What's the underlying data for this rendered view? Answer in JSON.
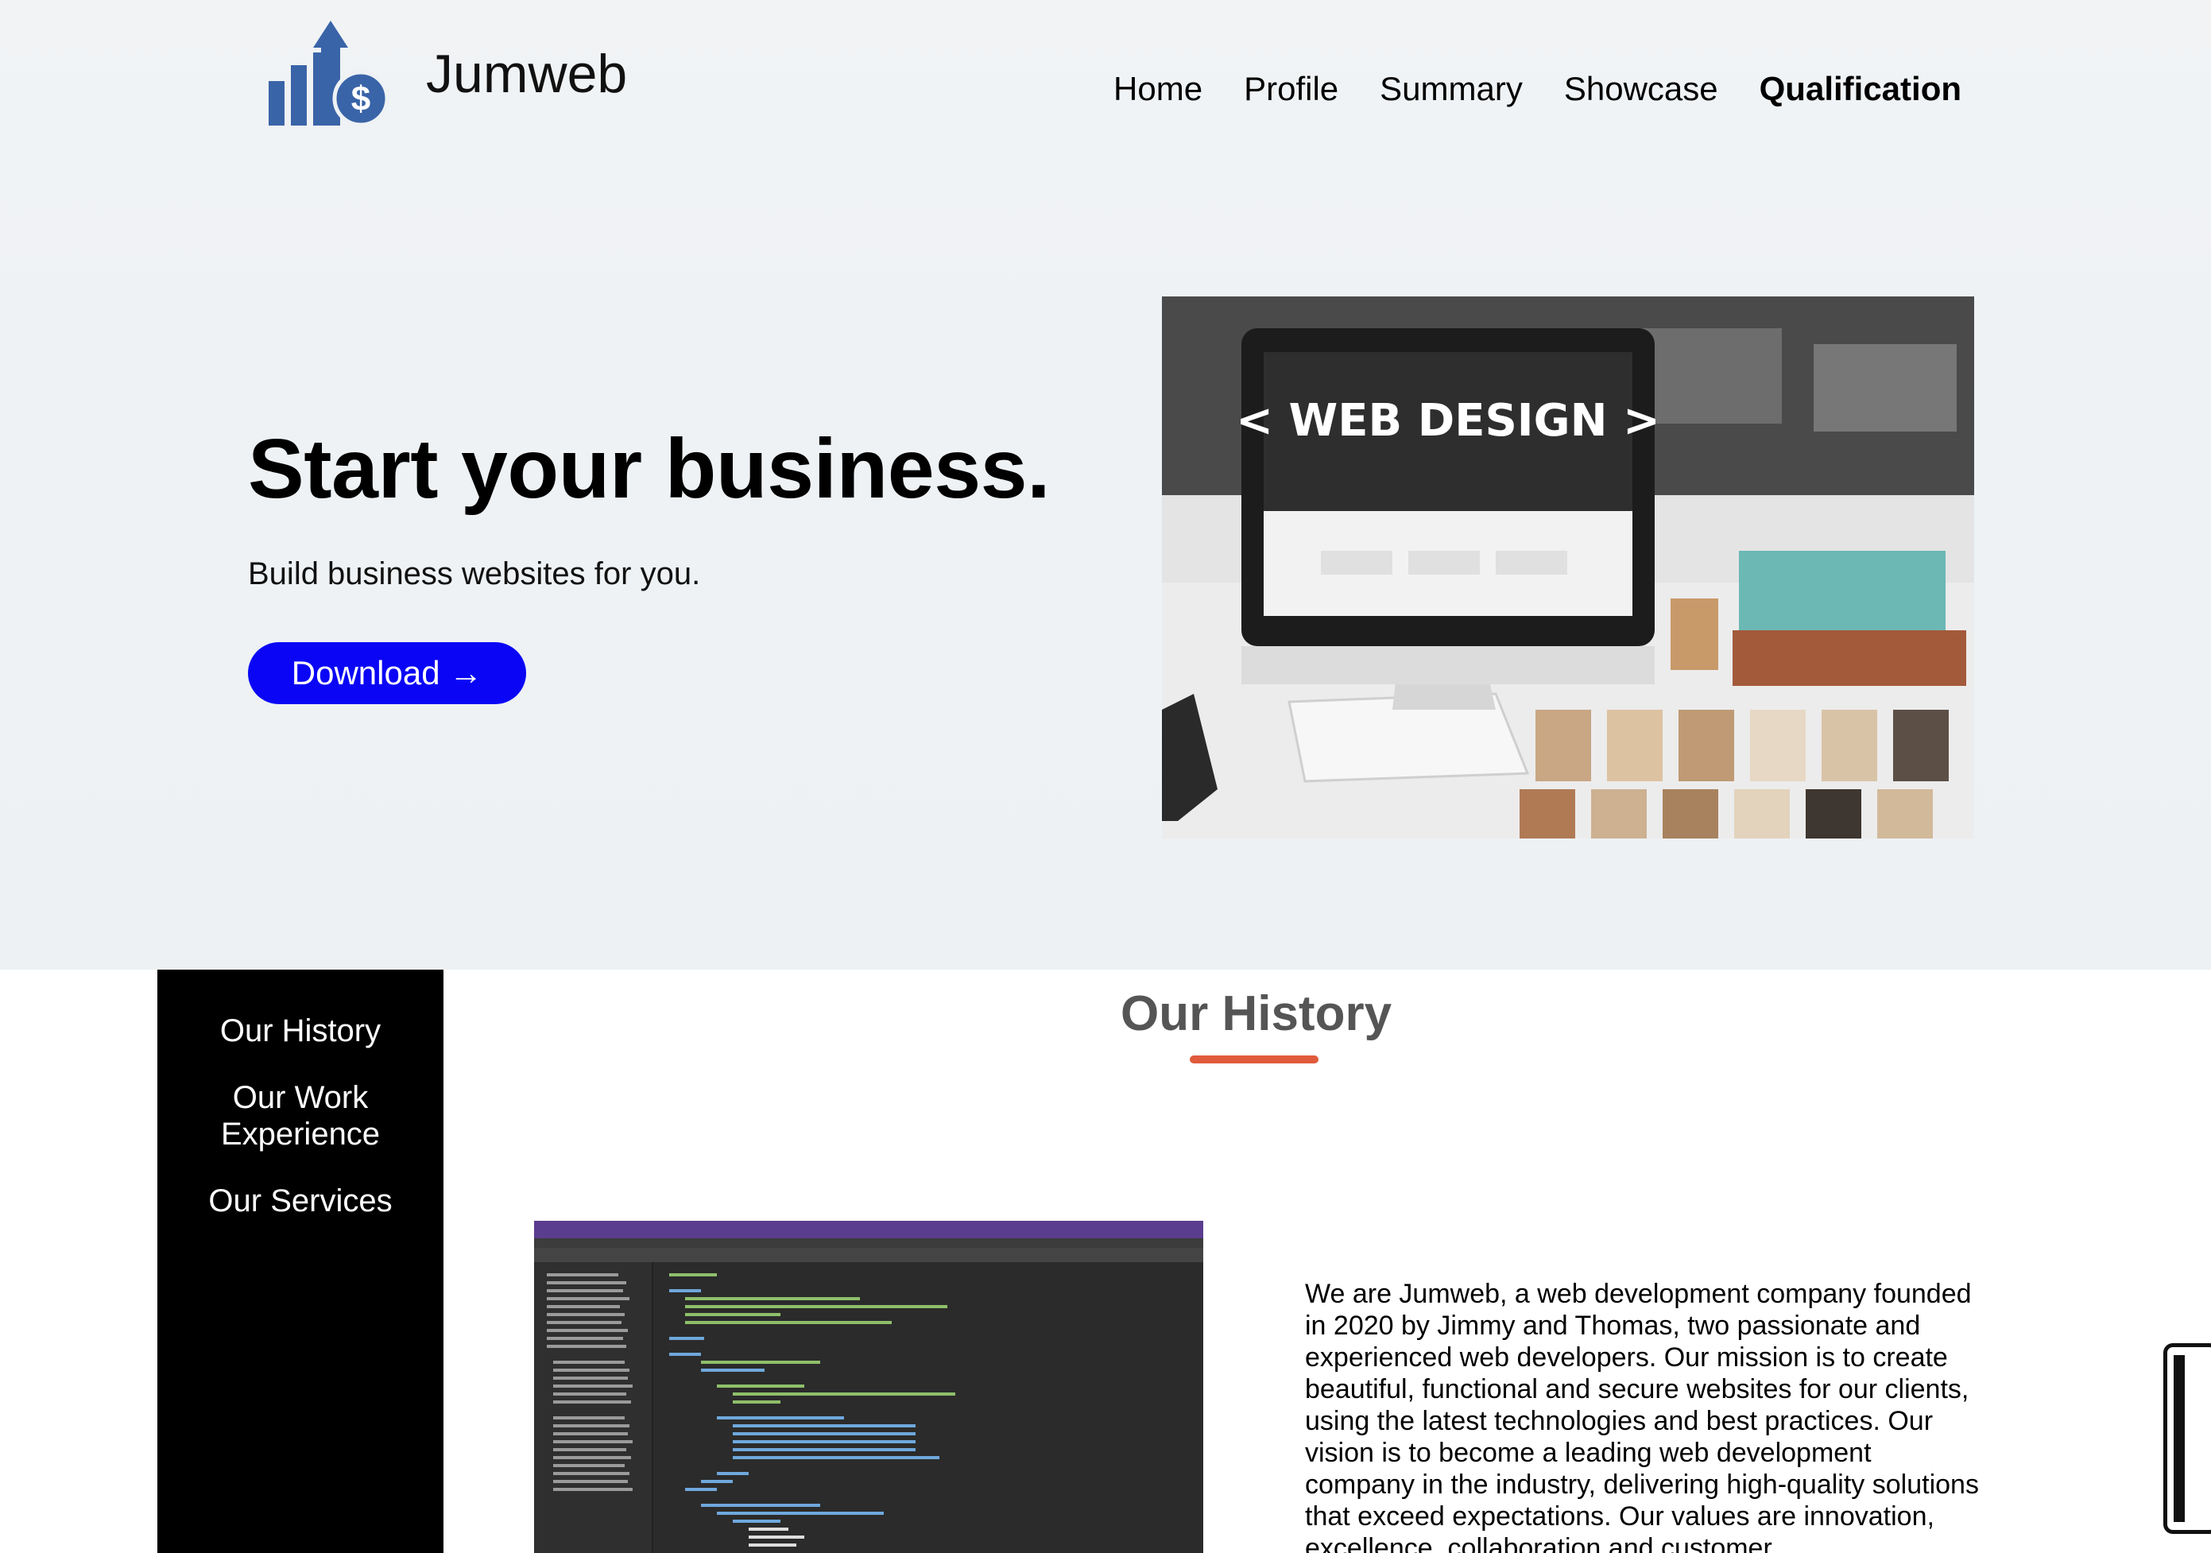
{
  "header": {
    "brand": "Jumweb",
    "logo_icon": "bar-chart-dollar-icon",
    "nav": [
      {
        "label": "Home",
        "active": false
      },
      {
        "label": "Profile",
        "active": false
      },
      {
        "label": "Summary",
        "active": false
      },
      {
        "label": "Showcase",
        "active": false
      },
      {
        "label": "Qualification",
        "active": true
      }
    ]
  },
  "hero": {
    "title": "Start your business.",
    "subtitle": "Build business websites for you.",
    "download_label": "Download →",
    "image_text": "< WEB DESIGN >"
  },
  "sidebar": {
    "items": [
      {
        "label": "Our History"
      },
      {
        "label": "Our Work Experience"
      },
      {
        "label": "Our Services"
      }
    ]
  },
  "history": {
    "title": "Our History",
    "body": "We are Jumweb, a web development company founded in 2020 by Jimmy and Thomas, two passionate and experienced web developers. Our mission is to create beautiful, functional and secure websites for our clients, using the latest technologies and best practices. Our vision is to become a leading web development company in the industry, delivering high-quality solutions that exceed expectations. Our values are innovation, excellence, collaboration and customer"
  },
  "colors": {
    "accent": "#0a06f5",
    "logo_blue": "#3a64a8",
    "underline": "#e05a3c",
    "sidebar_bg": "#000000"
  }
}
